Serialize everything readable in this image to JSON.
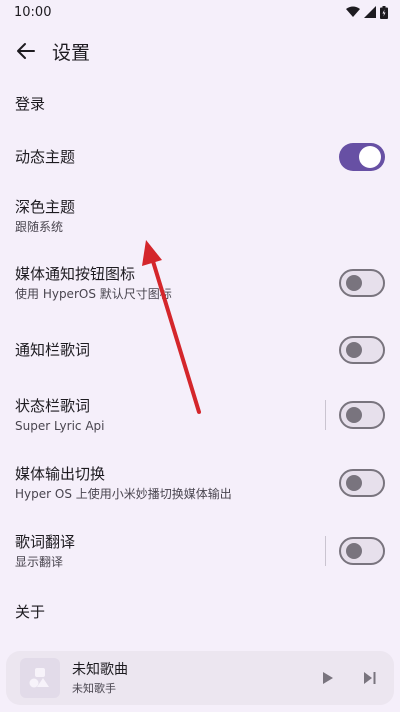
{
  "status_bar": {
    "time": "10:00"
  },
  "header": {
    "title": "设置"
  },
  "settings": [
    {
      "id": "login",
      "title": "登录"
    },
    {
      "id": "dynamic-theme",
      "title": "动态主题",
      "switch": "on"
    },
    {
      "id": "dark-theme",
      "title": "深色主题",
      "subtitle": "跟随系统"
    },
    {
      "id": "media-notif-icon",
      "title": "媒体通知按钮图标",
      "subtitle": "使用 HyperOS 默认尺寸图标",
      "switch": "off"
    },
    {
      "id": "notif-lyrics",
      "title": "通知栏歌词",
      "switch": "off"
    },
    {
      "id": "statusbar-lyrics",
      "title": "状态栏歌词",
      "subtitle": "Super Lyric Api",
      "switch": "off"
    },
    {
      "id": "media-output",
      "title": "媒体输出切换",
      "subtitle": "Hyper OS 上使用小米妙播切换媒体输出",
      "switch": "off"
    },
    {
      "id": "lyric-translate",
      "title": "歌词翻译",
      "subtitle": "显示翻译",
      "switch": "off"
    },
    {
      "id": "about",
      "title": "关于"
    }
  ],
  "player": {
    "title": "未知歌曲",
    "artist": "未知歌手"
  },
  "colors": {
    "accent": "#6750a4",
    "background": "#f5effa",
    "annotation_arrow": "#d4262b"
  }
}
